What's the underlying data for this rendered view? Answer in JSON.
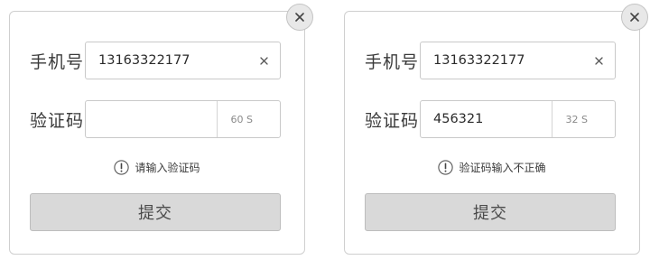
{
  "dialogs": [
    {
      "phone_label": "手机号",
      "phone_value": "13163322177",
      "code_label": "验证码",
      "code_value": "",
      "timer": "60 S",
      "message": "请输入验证码",
      "submit_label": "提交"
    },
    {
      "phone_label": "手机号",
      "phone_value": "13163322177",
      "code_label": "验证码",
      "code_value": "456321",
      "timer": "32 S",
      "message": "验证码输入不正确",
      "submit_label": "提交"
    }
  ],
  "icons": {
    "close": "close-icon",
    "clear": "clear-icon",
    "warning": "warning-icon"
  },
  "colors": {
    "border": "#cfcfcf",
    "button_bg": "#d9d9d9",
    "close_bg": "#e8e8e8",
    "text": "#333333",
    "muted": "#8a8a8a"
  }
}
